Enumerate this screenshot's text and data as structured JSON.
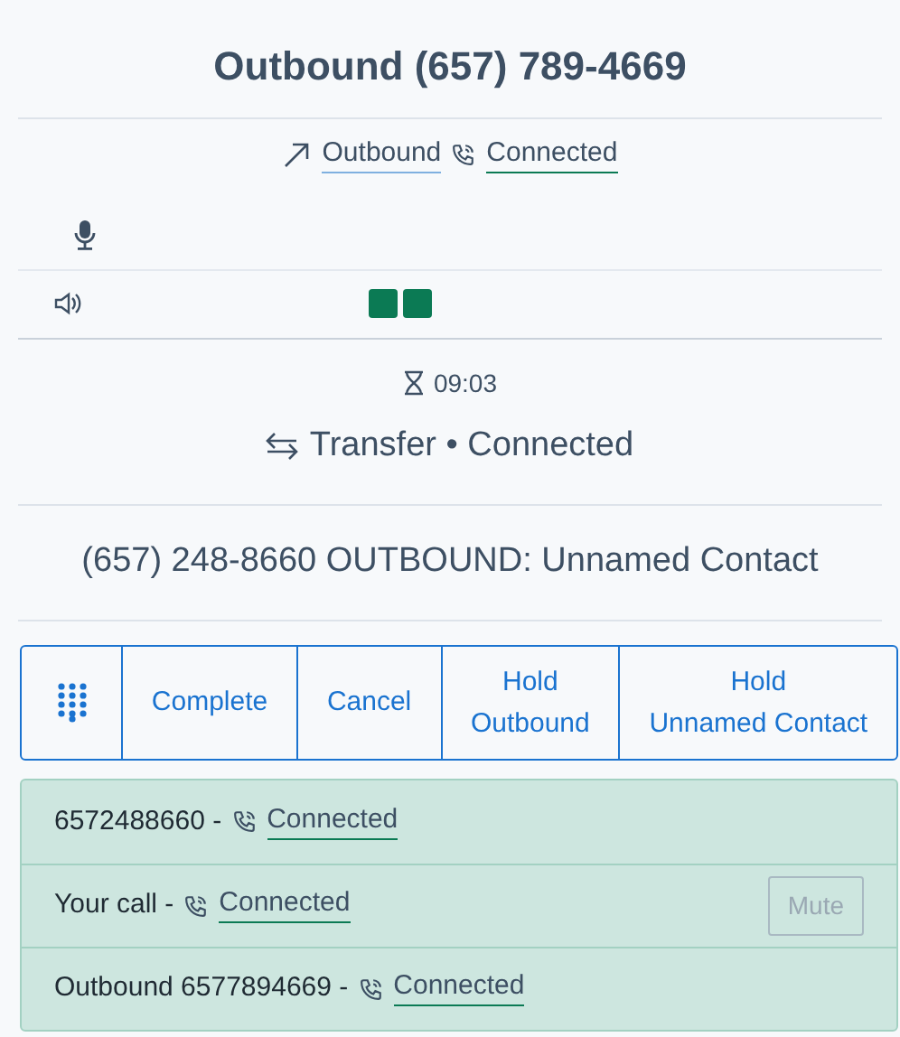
{
  "title": "Outbound (657) 789-4669",
  "status": {
    "direction": "Outbound",
    "state": "Connected"
  },
  "timer": "09:03",
  "transfer": "Transfer • Connected",
  "contact": "(657) 248-8660 OUTBOUND: Unnamed Contact",
  "actions": [
    {
      "kind": "keypad"
    },
    {
      "kind": "text",
      "lines": [
        "Complete"
      ]
    },
    {
      "kind": "text",
      "lines": [
        "Cancel"
      ]
    },
    {
      "kind": "text",
      "lines": [
        "Hold",
        "Outbound"
      ]
    },
    {
      "kind": "text",
      "lines": [
        "Hold",
        "Unnamed Contact"
      ]
    }
  ],
  "participants": [
    {
      "name": "6572488660 -",
      "state": "Connected"
    },
    {
      "name": "Your call -",
      "state": "Connected",
      "mute": {
        "label": "Mute",
        "disabled": true
      }
    },
    {
      "name": "Outbound 6577894669 -",
      "state": "Connected"
    }
  ]
}
